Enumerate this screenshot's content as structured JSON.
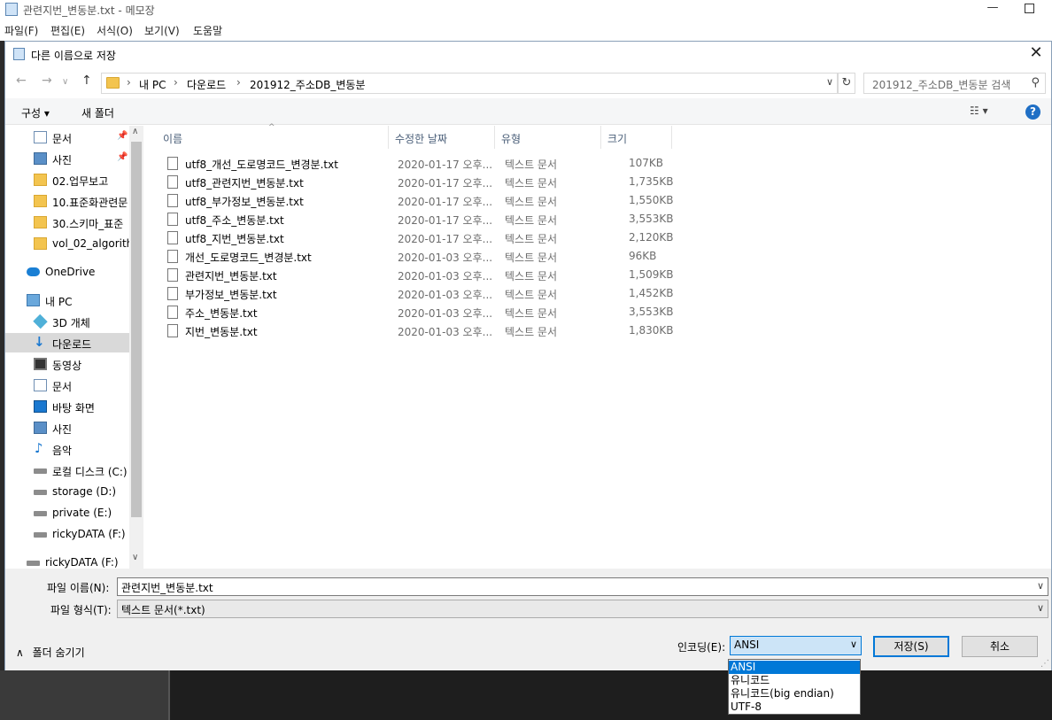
{
  "notepad": {
    "title": "관련지번_변동분.txt - 메모장",
    "menu": [
      "파일(F)",
      "편집(E)",
      "서식(O)",
      "보기(V)",
      "도움말"
    ]
  },
  "dialog": {
    "title": "다른 이름으로 저장",
    "address": {
      "crumbs": [
        "내 PC",
        "다운로드",
        "201912_주소DB_변동분"
      ]
    },
    "search_placeholder": "201912_주소DB_변동분 검색",
    "toolbar": {
      "organize": "구성 ▾",
      "new_folder": "새 폴더",
      "help": "?"
    },
    "nav": {
      "items": [
        {
          "label": "문서",
          "icon": "document-icon",
          "pinned": true
        },
        {
          "label": "사진",
          "icon": "pictures-icon",
          "pinned": true
        },
        {
          "label": "02.업무보고",
          "icon": "folder-icon"
        },
        {
          "label": "10.표준화관련문",
          "icon": "folder-icon"
        },
        {
          "label": "30.스키마_표준",
          "icon": "folder-icon"
        },
        {
          "label": "vol_02_algorithr",
          "icon": "folder-icon"
        },
        {
          "label": "OneDrive",
          "icon": "onedrive-icon"
        },
        {
          "label": "내 PC",
          "icon": "pc-icon"
        },
        {
          "label": "3D 개체",
          "icon": "3d-objects-icon"
        },
        {
          "label": "다운로드",
          "icon": "downloads-icon",
          "selected": true
        },
        {
          "label": "동영상",
          "icon": "videos-icon"
        },
        {
          "label": "문서",
          "icon": "document-icon"
        },
        {
          "label": "바탕 화면",
          "icon": "desktop-icon"
        },
        {
          "label": "사진",
          "icon": "pictures-icon"
        },
        {
          "label": "음악",
          "icon": "music-icon"
        },
        {
          "label": "로컬 디스크 (C:)",
          "icon": "drive-icon"
        },
        {
          "label": "storage (D:)",
          "icon": "drive-icon"
        },
        {
          "label": "private (E:)",
          "icon": "drive-icon"
        },
        {
          "label": "rickyDATA (F:)",
          "icon": "drive-icon"
        },
        {
          "label": "rickyDATA (F:)",
          "icon": "drive-icon"
        }
      ]
    },
    "columns": {
      "name": "이름",
      "date": "수정한 날짜",
      "type": "유형",
      "size": "크기"
    },
    "files": [
      {
        "name": "utf8_개선_도로명코드_변경분.txt",
        "date": "2020-01-17 오후...",
        "type": "텍스트 문서",
        "size": "107KB"
      },
      {
        "name": "utf8_관련지번_변동분.txt",
        "date": "2020-01-17 오후...",
        "type": "텍스트 문서",
        "size": "1,735KB"
      },
      {
        "name": "utf8_부가정보_변동분.txt",
        "date": "2020-01-17 오후...",
        "type": "텍스트 문서",
        "size": "1,550KB"
      },
      {
        "name": "utf8_주소_변동분.txt",
        "date": "2020-01-17 오후...",
        "type": "텍스트 문서",
        "size": "3,553KB"
      },
      {
        "name": "utf8_지번_변동분.txt",
        "date": "2020-01-17 오후...",
        "type": "텍스트 문서",
        "size": "2,120KB"
      },
      {
        "name": "개선_도로명코드_변경분.txt",
        "date": "2020-01-03 오후...",
        "type": "텍스트 문서",
        "size": "96KB"
      },
      {
        "name": "관련지번_변동분.txt",
        "date": "2020-01-03 오후...",
        "type": "텍스트 문서",
        "size": "1,509KB"
      },
      {
        "name": "부가정보_변동분.txt",
        "date": "2020-01-03 오후...",
        "type": "텍스트 문서",
        "size": "1,452KB"
      },
      {
        "name": "주소_변동분.txt",
        "date": "2020-01-03 오후...",
        "type": "텍스트 문서",
        "size": "3,553KB"
      },
      {
        "name": "지번_변동분.txt",
        "date": "2020-01-03 오후...",
        "type": "텍스트 문서",
        "size": "1,830KB"
      }
    ],
    "filename_label": "파일 이름(N):",
    "filename_value": "관련지번_변동분.txt",
    "filetype_label": "파일 형식(T):",
    "filetype_value": "텍스트 문서(*.txt)",
    "hide_folders": "폴더 숨기기",
    "encoding_label": "인코딩(E):",
    "encoding_value": "ANSI",
    "encoding_options": [
      "ANSI",
      "유니코드",
      "유니코드(big endian)",
      "UTF-8"
    ],
    "save_button": "저장(S)",
    "cancel_button": "취소"
  },
  "colors": {
    "accent": "#0078d7",
    "selection": "#cce4f7",
    "header_text": "#4c607a"
  }
}
